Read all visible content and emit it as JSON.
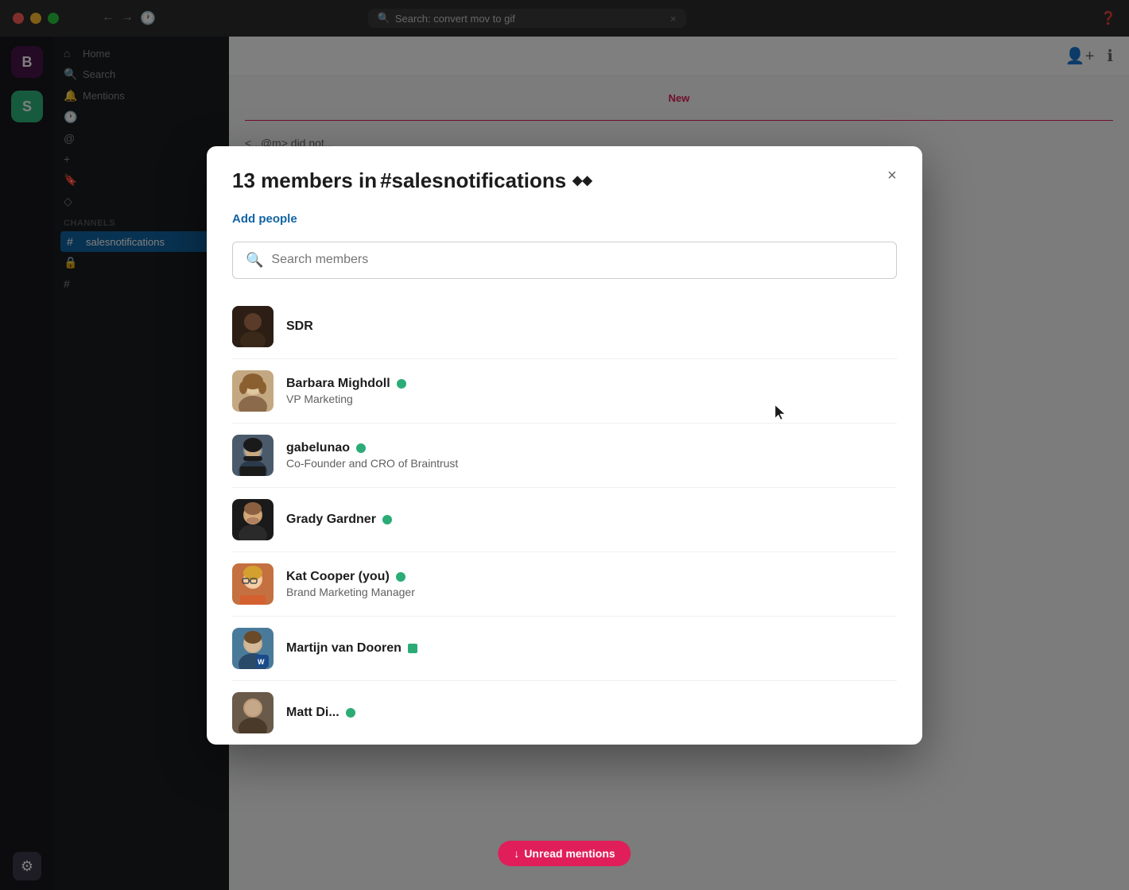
{
  "window": {
    "title": "Search: convert mov to gif",
    "traffic_lights": [
      "close",
      "minimize",
      "maximize"
    ]
  },
  "sidebar": {
    "workspace_b_label": "B",
    "workspace_s_label": "S",
    "icons": [
      {
        "name": "home",
        "symbol": "🏠",
        "active": false
      },
      {
        "name": "search",
        "symbol": "🔍",
        "active": false
      },
      {
        "name": "bell",
        "symbol": "🔔",
        "active": false
      },
      {
        "name": "clock",
        "symbol": "🕐",
        "active": false
      },
      {
        "name": "at",
        "symbol": "@",
        "active": false
      },
      {
        "name": "plus",
        "symbol": "+",
        "active": false
      },
      {
        "name": "bookmark",
        "symbol": "🔖",
        "active": false
      },
      {
        "name": "diamond",
        "symbol": "◇",
        "active": false
      },
      {
        "name": "ellipsis",
        "symbol": "⋮",
        "active": false
      },
      {
        "name": "chevron",
        "symbol": "▾",
        "active": false
      },
      {
        "name": "lock",
        "symbol": "🔒",
        "active": false
      },
      {
        "name": "gear",
        "symbol": "⚙",
        "active": true
      }
    ]
  },
  "modal": {
    "title_prefix": "13 members in ",
    "channel_name": "#salesnotifications",
    "channel_icon": "◆◆",
    "add_people_label": "Add people",
    "search_placeholder": "Search members",
    "close_label": "×",
    "members": [
      {
        "id": "sdr",
        "name": "SDR",
        "role": "",
        "status": "online",
        "avatar_color": "dark"
      },
      {
        "id": "barbara",
        "name": "Barbara Mighdoll",
        "role": "VP Marketing",
        "status": "online",
        "avatar_color": "tan"
      },
      {
        "id": "gabelunao",
        "name": "gabelunao",
        "role": "Co-Founder and CRO of Braintrust",
        "status": "online",
        "avatar_color": "olive"
      },
      {
        "id": "grady",
        "name": "Grady Gardner",
        "role": "",
        "status": "online",
        "avatar_color": "dark"
      },
      {
        "id": "kat",
        "name": "Kat Cooper (you)",
        "role": "Brand Marketing Manager",
        "status": "online",
        "avatar_color": "amber"
      },
      {
        "id": "martijn",
        "name": "Martijn van Dooren",
        "role": "",
        "status": "away",
        "avatar_color": "blue"
      },
      {
        "id": "matt",
        "name": "Matt Di...",
        "role": "",
        "status": "online",
        "avatar_color": "brown"
      }
    ]
  },
  "content": {
    "new_label": "New"
  },
  "unread_btn": {
    "label": "Unread mentions",
    "icon": "↓"
  }
}
